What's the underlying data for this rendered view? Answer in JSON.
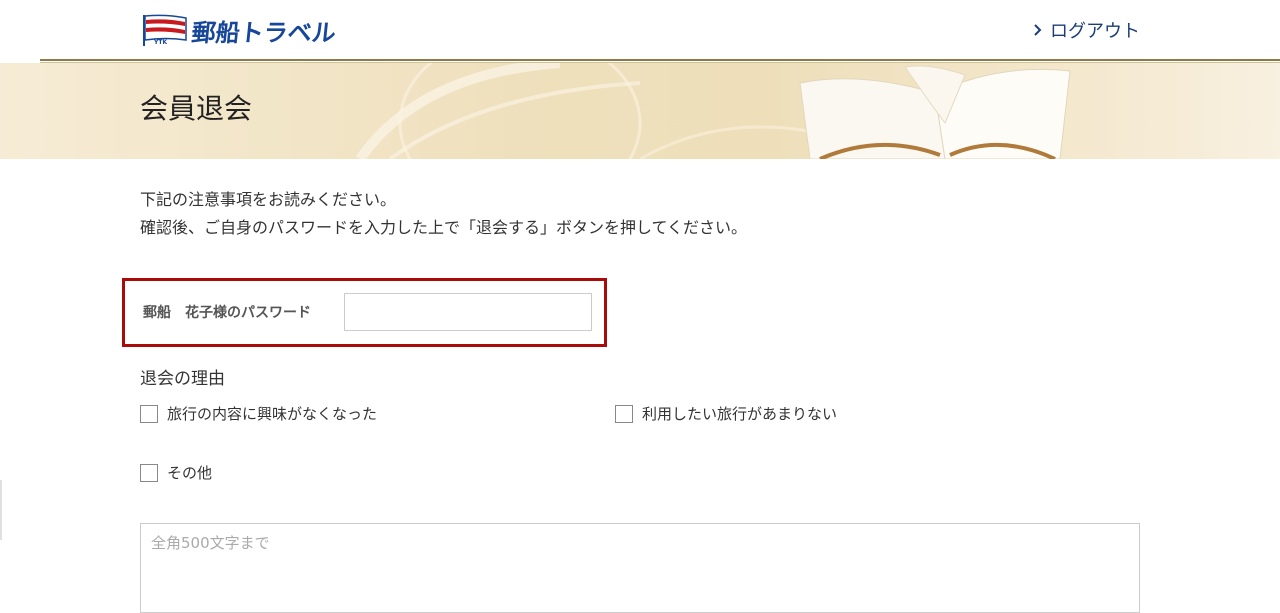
{
  "header": {
    "logo_text": "郵船トラベル",
    "logo_badge": "YTK",
    "logout_label": "ログアウト"
  },
  "banner": {
    "title": "会員退会"
  },
  "intro": {
    "line1": "下記の注意事項をお読みください。",
    "line2": "確認後、ご自身のパスワードを入力した上で「退会する」ボタンを押してください。"
  },
  "password": {
    "label": "郵船　花子様のパスワード",
    "value": ""
  },
  "reasons": {
    "heading": "退会の理由",
    "options": [
      {
        "label": "旅行の内容に興味がなくなった",
        "checked": false
      },
      {
        "label": "利用したい旅行があまりない",
        "checked": false
      },
      {
        "label": "その他",
        "checked": false
      }
    ]
  },
  "comment": {
    "placeholder": "全角500文字まで",
    "value": ""
  },
  "colors": {
    "brand_blue": "#16479a",
    "brand_red": "#c8191f",
    "highlight_border": "#a90a0a",
    "gold_rule": "#8f7a45"
  }
}
